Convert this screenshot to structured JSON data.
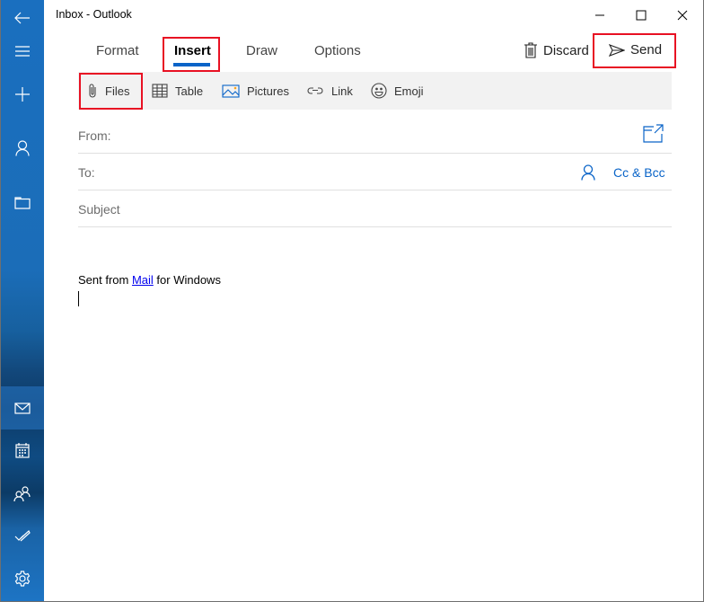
{
  "window": {
    "title": "Inbox - Outlook",
    "controls": {
      "minimize": "minimize-icon",
      "maximize": "maximize-icon",
      "close": "close-icon"
    }
  },
  "sidebar": {
    "top_items": [
      {
        "name": "back",
        "icon": "back-arrow-icon"
      },
      {
        "name": "menu",
        "icon": "hamburger-icon"
      },
      {
        "name": "new-mail",
        "icon": "plus-icon"
      },
      {
        "name": "accounts",
        "icon": "person-icon"
      },
      {
        "name": "folders",
        "icon": "folder-icon"
      }
    ],
    "bottom_items": [
      {
        "name": "mail",
        "icon": "mail-icon",
        "active": true
      },
      {
        "name": "calendar",
        "icon": "calendar-icon"
      },
      {
        "name": "people",
        "icon": "people-icon"
      },
      {
        "name": "todo",
        "icon": "checkmark-icon"
      },
      {
        "name": "settings",
        "icon": "gear-icon"
      }
    ]
  },
  "ribbon": {
    "tabs": [
      {
        "label": "Format"
      },
      {
        "label": "Insert",
        "active": true
      },
      {
        "label": "Draw"
      },
      {
        "label": "Options"
      }
    ],
    "actions": {
      "discard_label": "Discard",
      "send_label": "Send"
    },
    "insert_toolbar": [
      {
        "label": "Files",
        "icon": "paperclip-icon"
      },
      {
        "label": "Table",
        "icon": "table-icon"
      },
      {
        "label": "Pictures",
        "icon": "picture-icon"
      },
      {
        "label": "Link",
        "icon": "link-icon"
      },
      {
        "label": "Emoji",
        "icon": "emoji-icon"
      }
    ]
  },
  "compose": {
    "from_label": "From:",
    "to_label": "To:",
    "cc_bcc_label": "Cc & Bcc",
    "subject_placeholder": "Subject",
    "subject_value": "",
    "signature": {
      "prefix": "Sent from ",
      "link_text": "Mail",
      "suffix": " for Windows"
    }
  },
  "highlights": [
    "Insert tab",
    "Files button",
    "Send button"
  ],
  "colors": {
    "accent": "#0a64c8",
    "highlight_box": "#e81123",
    "sidebar": "#1a6fbf",
    "toolbar_bg": "#f2f2f2"
  }
}
